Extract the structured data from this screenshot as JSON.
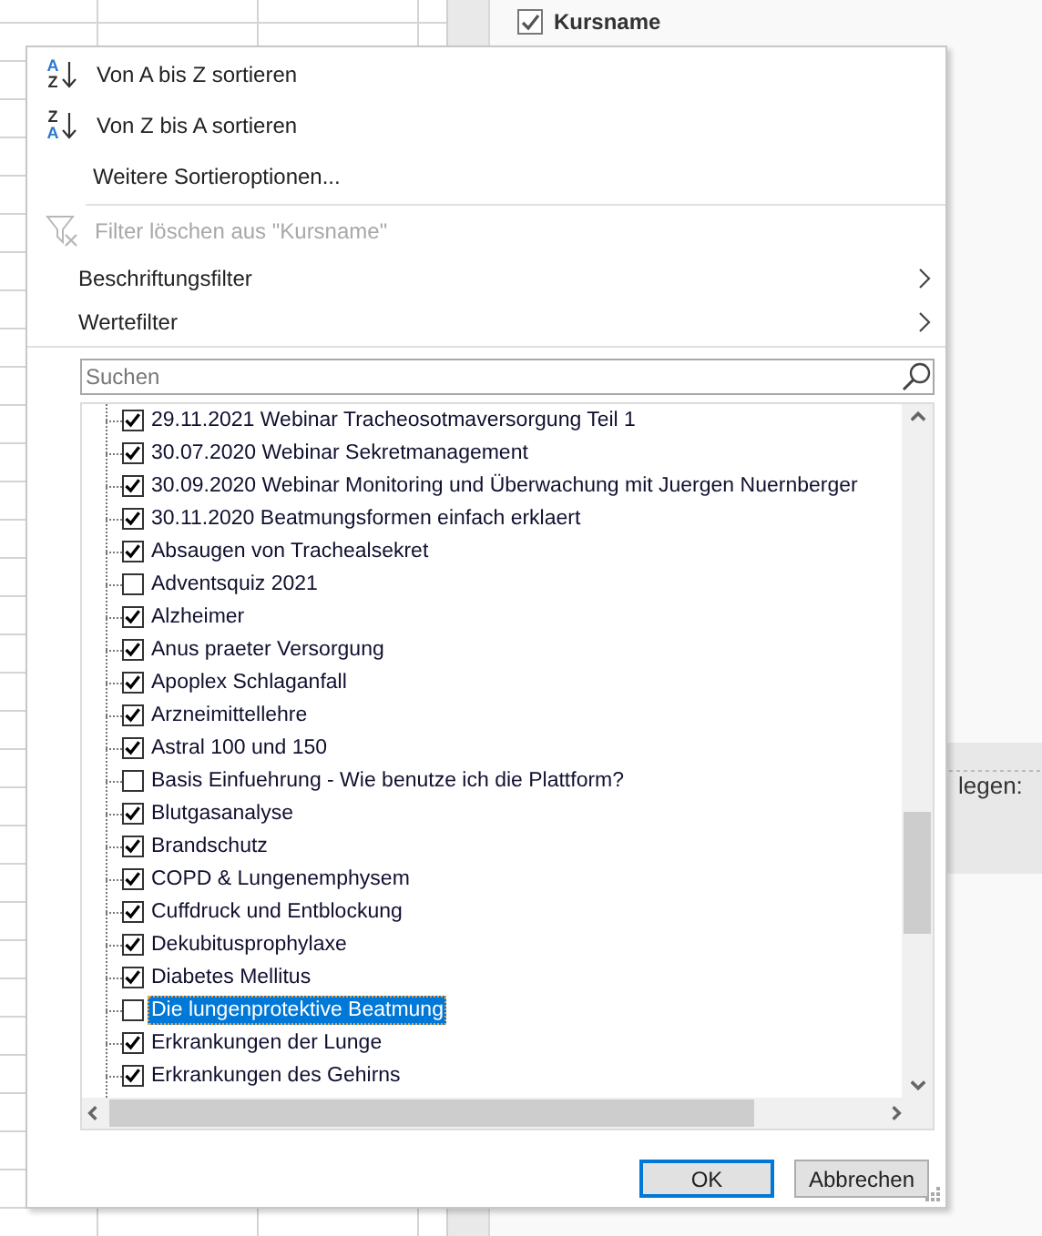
{
  "field_header": {
    "label": "Kursname",
    "checked": true
  },
  "side_panel": {
    "text": "legen:"
  },
  "menu": {
    "sort_options": [
      {
        "letters": [
          {
            "text": "A",
            "highlighted": true
          },
          {
            "text": "Z",
            "highlighted": false
          }
        ],
        "label": "Von A bis Z sortieren"
      },
      {
        "letters": [
          {
            "text": "Z",
            "highlighted": false
          },
          {
            "text": "A",
            "highlighted": true
          }
        ],
        "label": "Von Z bis A sortieren"
      }
    ],
    "more_sort": "Weitere Sortieroptionen...",
    "clear_filter": {
      "label": "Filter löschen aus \"Kursname\"",
      "disabled": true
    },
    "submenus": [
      {
        "label": "Beschriftungsfilter"
      },
      {
        "label": "Wertefilter"
      }
    ],
    "search": {
      "placeholder": "Suchen"
    },
    "items": [
      {
        "label": "29.11.2021 Webinar Tracheosotmaversorgung Teil 1",
        "checked": true,
        "selected": false
      },
      {
        "label": "30.07.2020 Webinar Sekretmanagement",
        "checked": true,
        "selected": false
      },
      {
        "label": "30.09.2020 Webinar Monitoring und Überwachung mit Juergen Nuernberger",
        "checked": true,
        "selected": false
      },
      {
        "label": "30.11.2020 Beatmungsformen einfach erklaert",
        "checked": true,
        "selected": false
      },
      {
        "label": "Absaugen von Trachealsekret",
        "checked": true,
        "selected": false
      },
      {
        "label": "Adventsquiz 2021",
        "checked": false,
        "selected": false
      },
      {
        "label": "Alzheimer",
        "checked": true,
        "selected": false
      },
      {
        "label": "Anus praeter Versorgung",
        "checked": true,
        "selected": false
      },
      {
        "label": "Apoplex Schlaganfall",
        "checked": true,
        "selected": false
      },
      {
        "label": "Arzneimittellehre",
        "checked": true,
        "selected": false
      },
      {
        "label": "Astral 100 und 150",
        "checked": true,
        "selected": false
      },
      {
        "label": "Basis Einfuehrung - Wie benutze ich die Plattform?",
        "checked": false,
        "selected": false
      },
      {
        "label": "Blutgasanalyse",
        "checked": true,
        "selected": false
      },
      {
        "label": "Brandschutz",
        "checked": true,
        "selected": false
      },
      {
        "label": "COPD & Lungenemphysem",
        "checked": true,
        "selected": false
      },
      {
        "label": "Cuffdruck und Entblockung",
        "checked": true,
        "selected": false
      },
      {
        "label": "Dekubitusprophylaxe",
        "checked": true,
        "selected": false
      },
      {
        "label": "Diabetes Mellitus",
        "checked": true,
        "selected": false
      },
      {
        "label": "Die lungenprotektive Beatmung",
        "checked": false,
        "selected": true
      },
      {
        "label": "Erkrankungen der Lunge",
        "checked": true,
        "selected": false
      },
      {
        "label": "Erkrankungen des Gehirns",
        "checked": true,
        "selected": false
      }
    ],
    "buttons": [
      {
        "label": "OK",
        "default": true
      },
      {
        "label": "Abbrechen",
        "default": false
      }
    ]
  }
}
